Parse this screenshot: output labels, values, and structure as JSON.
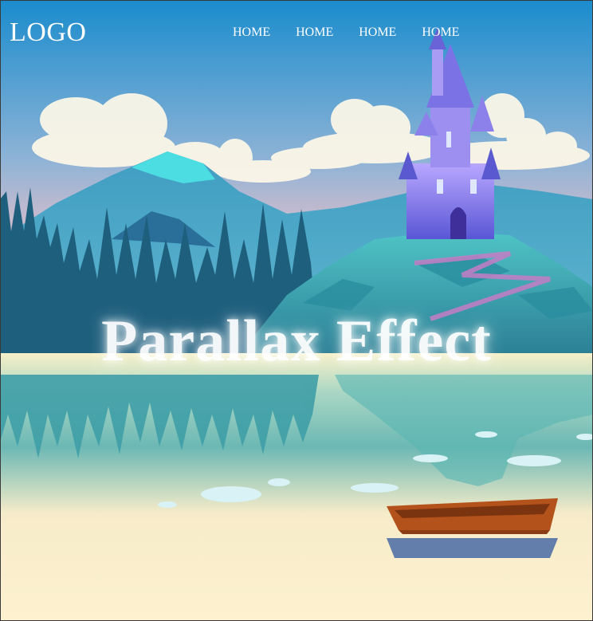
{
  "header": {
    "logo": "LOGO",
    "nav": [
      {
        "label": "HOME"
      },
      {
        "label": "HOME"
      },
      {
        "label": "HOME"
      },
      {
        "label": "HOME"
      }
    ]
  },
  "hero": {
    "title": "Parallax Effect"
  },
  "colors": {
    "sky_top": "#1f8fd0",
    "sky_bottom": "#f9c8c9",
    "water": "#fdf1cf",
    "mountain": "#2f86a8",
    "forest": "#1f5f7e",
    "castle": "#7b72e6",
    "boat": "#b4521b"
  }
}
